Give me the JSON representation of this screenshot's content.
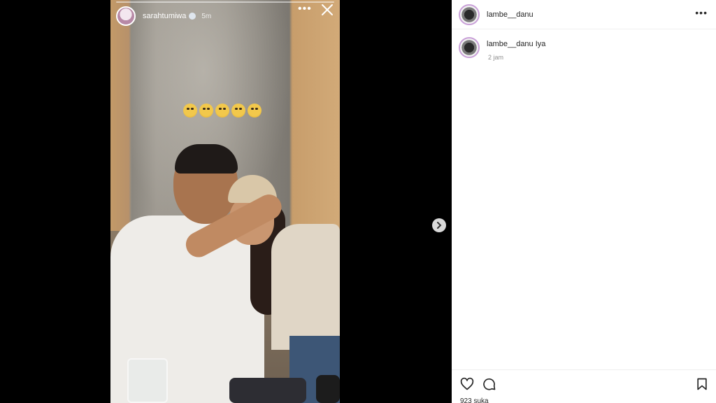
{
  "story": {
    "username": "sarahtumiwa",
    "time": "5m",
    "more_label": "•••"
  },
  "panel": {
    "header_username": "lambe__danu",
    "more_label": "•••",
    "caption_username": "lambe__danu",
    "caption_text": "Iya",
    "caption_time": "2 jam",
    "likes_text": "923 suka"
  },
  "icons": {
    "close": "close-icon",
    "next": "chevron-right-icon",
    "like": "heart-icon",
    "comment": "comment-icon",
    "save": "bookmark-icon",
    "verified": "verified-badge-icon"
  }
}
